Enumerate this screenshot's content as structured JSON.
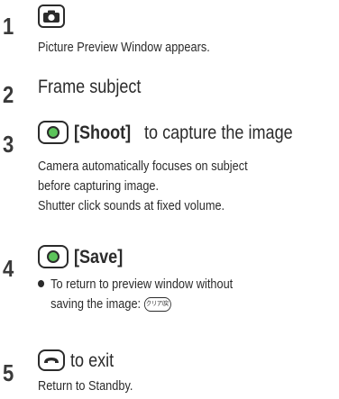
{
  "steps": [
    {
      "number": "1",
      "key_icon": "camera-key-icon",
      "heading": "",
      "description": [
        "Picture Preview Window appears."
      ]
    },
    {
      "number": "2",
      "heading": "Frame subject"
    },
    {
      "number": "3",
      "key_icon": "center-key-icon",
      "heading_bold": "[Shoot]",
      "heading_rest": " to capture the image",
      "description": [
        "Camera automatically focuses on subject",
        "before capturing image.",
        "Shutter click sounds at fixed volume."
      ]
    },
    {
      "number": "4",
      "key_icon": "center-key-icon",
      "heading_bold": "[Save]",
      "bullet": "To return to preview window without",
      "bullet_cont": "saving the image:",
      "bullet_key_label": "クリア/戻"
    },
    {
      "number": "5",
      "key_icon": "end-key-icon",
      "heading_rest": "to exit",
      "description": [
        "Return to Standby."
      ]
    }
  ],
  "colors": {
    "text": "#2b2b2b",
    "key_dot": "#5cc45a"
  }
}
